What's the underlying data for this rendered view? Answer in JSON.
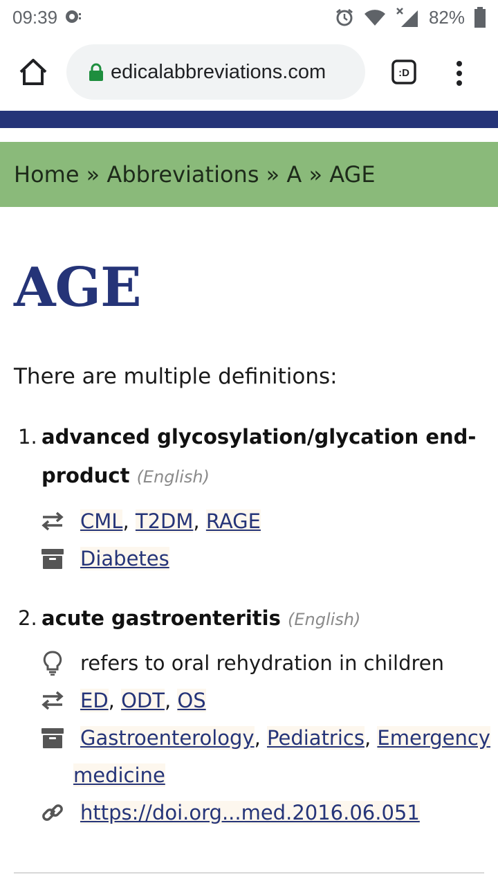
{
  "status_bar": {
    "time": "09:39",
    "battery": "82%"
  },
  "browser": {
    "url": "edicalabbreviations.com"
  },
  "breadcrumb": {
    "home": "Home",
    "sep": " » ",
    "abbreviations": "Abbreviations",
    "letter": "A",
    "current": "AGE"
  },
  "page": {
    "title": "AGE",
    "intro": "There are multiple definitions:",
    "definitions": [
      {
        "number": "1.",
        "term_line1": "advanced glycosylation/glycation end-",
        "term_line2": "product",
        "language": "(English)",
        "related": [
          "CML",
          "T2DM",
          "RAGE"
        ],
        "categories": [
          "Diabetes"
        ]
      },
      {
        "number": "2.",
        "term": "acute gastroenteritis",
        "language": "(English)",
        "note": "refers to oral rehydration in children",
        "related": [
          "ED",
          "ODT",
          "OS"
        ],
        "categories": [
          "Gastroenterology",
          "Pediatrics",
          "Emergency",
          "medicine"
        ],
        "link": "https://doi.org...med.2016.06.051"
      }
    ]
  },
  "colors": {
    "navy": "#253478",
    "green": "#8aba7a"
  }
}
